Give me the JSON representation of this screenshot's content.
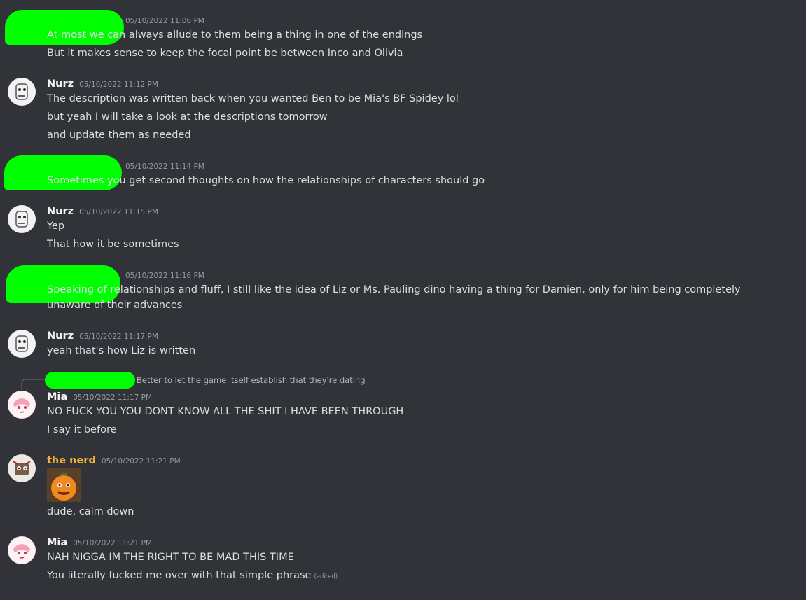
{
  "messages": [
    {
      "timestamp": "05/10/2022 11:06 PM",
      "lines": [
        "At most we can always allude to them being a thing in one of the endings",
        "But it makes sense to keep the focal point be between Inco and Olivia"
      ]
    },
    {
      "author": "Nurz",
      "timestamp": "05/10/2022 11:12 PM",
      "lines": [
        "The description was written back when you wanted Ben to be Mia's BF Spidey lol",
        "but yeah I will take a look at the descriptions tomorrow",
        "and update them as needed"
      ]
    },
    {
      "timestamp": "05/10/2022 11:14 PM",
      "lines": [
        "Sometimes you get second thoughts on how the relationships of characters should go"
      ]
    },
    {
      "author": "Nurz",
      "timestamp": "05/10/2022 11:15 PM",
      "lines": [
        "Yep",
        "That how it be sometimes"
      ]
    },
    {
      "timestamp": "05/10/2022 11:16 PM",
      "lines": [
        "Speaking of relationships and fluff, I still like the idea of Liz or Ms. Pauling dino having a thing for Damien, only for him being completely unaware of their advances"
      ]
    },
    {
      "author": "Nurz",
      "timestamp": "05/10/2022 11:17 PM",
      "lines": [
        "yeah that's how Liz is written"
      ]
    },
    {
      "reply_preview": "Better to let the game itself establish that they're dating",
      "author": "Mia",
      "timestamp": "05/10/2022 11:17 PM",
      "lines": [
        "NO FUCK YOU YOU DONT KNOW ALL THE SHIT I HAVE BEEN THROUGH",
        "I say it before"
      ]
    },
    {
      "author": "the nerd",
      "author_color": "#f0b232",
      "timestamp": "05/10/2022 11:21 PM",
      "lines": [
        "dude, calm down"
      ]
    },
    {
      "author": "Mia",
      "timestamp": "05/10/2022 11:21 PM",
      "lines": [
        "NAH NIGGA IM THE RIGHT TO BE MAD THIS TIME",
        "You literally fucked me over with that simple phrase"
      ],
      "edited_label": "(edited)"
    }
  ],
  "colors": {
    "background": "#313338",
    "redaction": "#00ff00",
    "gold_name": "#f0b232"
  }
}
